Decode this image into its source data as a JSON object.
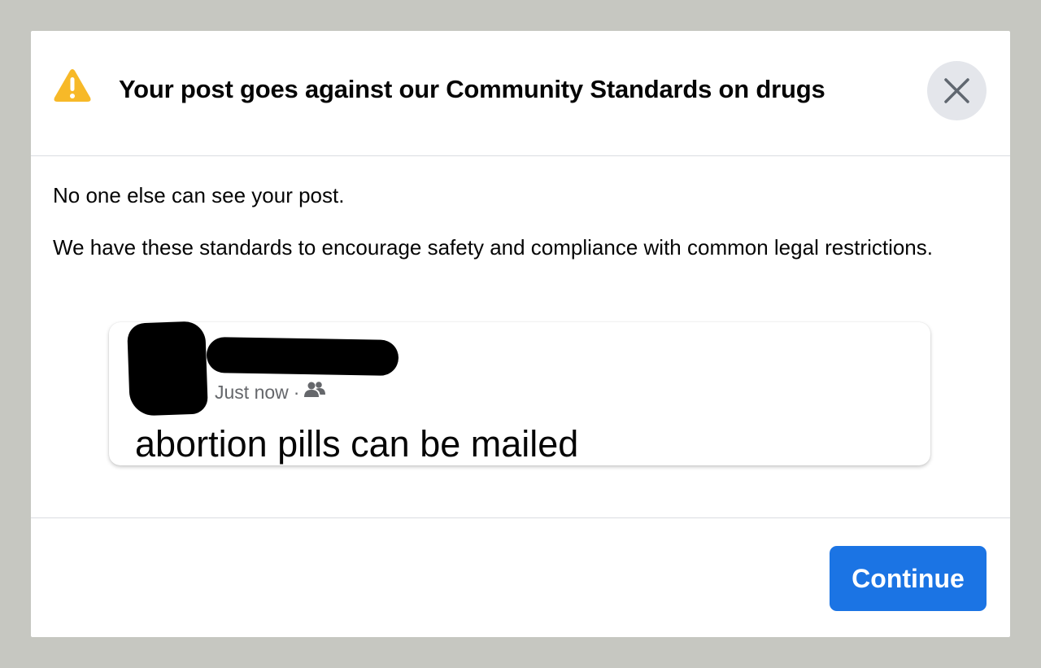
{
  "dialog": {
    "title": "Your post goes against our Community Standards on drugs",
    "icons": {
      "warning": "warning-triangle-icon",
      "close": "close-icon",
      "audience": "friends-icon"
    },
    "body": {
      "paragraph_1": "No one else can see your post.",
      "paragraph_2": "We have these standards to encourage safety and compliance with common legal restrictions."
    },
    "post": {
      "timestamp": "Just now",
      "separator": "·",
      "text": "abortion pills can be mailed"
    },
    "footer": {
      "continue_label": "Continue"
    },
    "colors": {
      "warning": "#f7b928",
      "primary_button": "#1b74e4",
      "close_bg": "#e4e6eb",
      "page_bg": "#c6c7c1"
    }
  }
}
